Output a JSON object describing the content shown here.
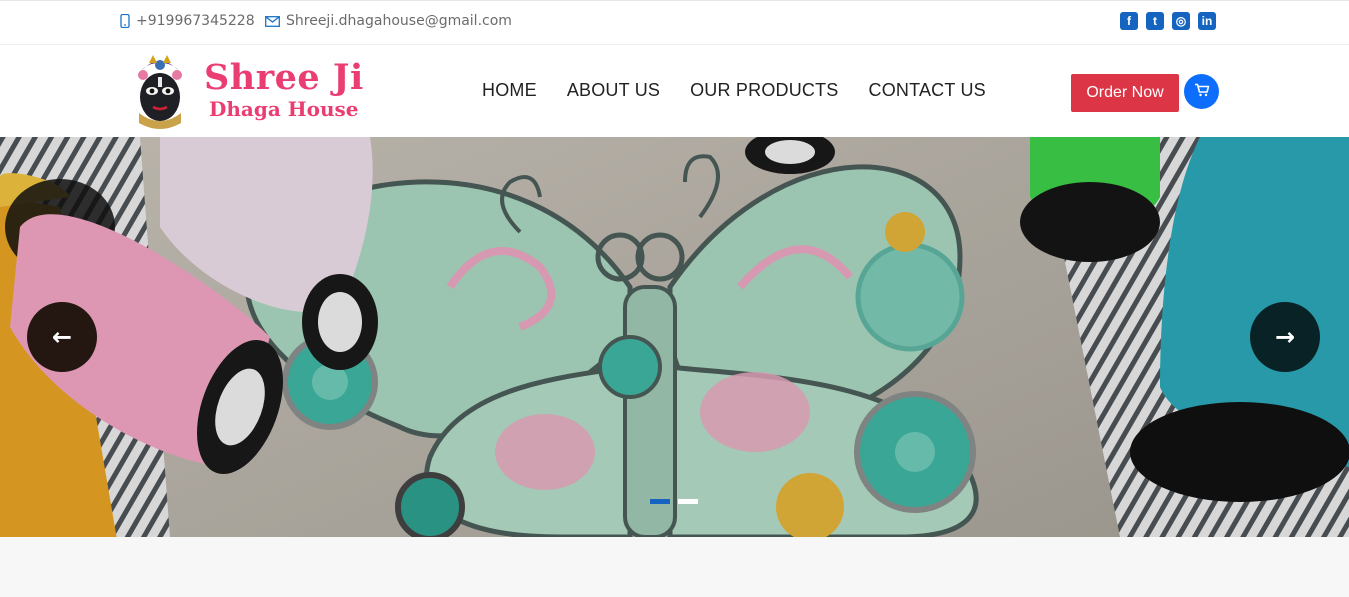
{
  "topbar": {
    "phone": "+919967345228",
    "email": "Shreeji.dhagahouse@gmail.com",
    "social": [
      {
        "icon": "facebook-icon",
        "glyph": "f"
      },
      {
        "icon": "twitter-icon",
        "glyph": "t"
      },
      {
        "icon": "instagram-icon",
        "glyph": "◎"
      },
      {
        "icon": "linkedin-icon",
        "glyph": "in"
      }
    ]
  },
  "header": {
    "brand_line1": "Shree Ji",
    "brand_line2": "Dhaga House",
    "nav": [
      "HOME",
      "ABOUT US",
      "OUR PRODUCTS",
      "CONTACT US"
    ],
    "order_label": "Order Now"
  },
  "slider": {
    "prev_glyph": "←",
    "next_glyph": "→",
    "slide_count": 2,
    "active_slide": 1
  },
  "colors": {
    "brand": "#ea3e73",
    "accent": "#1565c0",
    "order": "#dc3545"
  }
}
